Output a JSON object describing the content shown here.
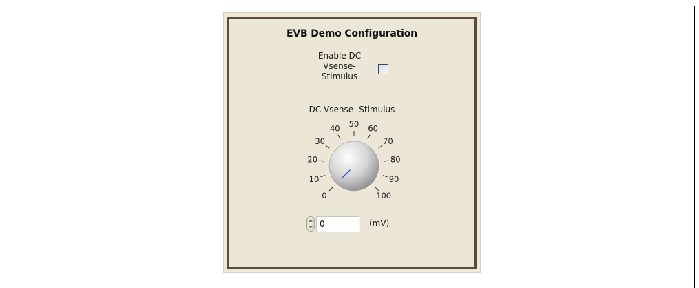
{
  "panel": {
    "title": "EVB Demo Configuration"
  },
  "enable_checkbox": {
    "label_lines": [
      "Enable DC",
      "Vsense-",
      "Stimulus"
    ],
    "checked": false
  },
  "knob": {
    "label": "DC Vsense- Stimulus",
    "min": 0,
    "max": 100,
    "value": 0,
    "ticks": [
      "0",
      "10",
      "20",
      "30",
      "40",
      "50",
      "60",
      "70",
      "80",
      "90",
      "100"
    ]
  },
  "numeric": {
    "value": "0",
    "unit": "(mV)"
  },
  "colors": {
    "panel_border": "#5c4a3c",
    "panel_bg": "#ebe6d6",
    "needle": "#2a56c9"
  }
}
